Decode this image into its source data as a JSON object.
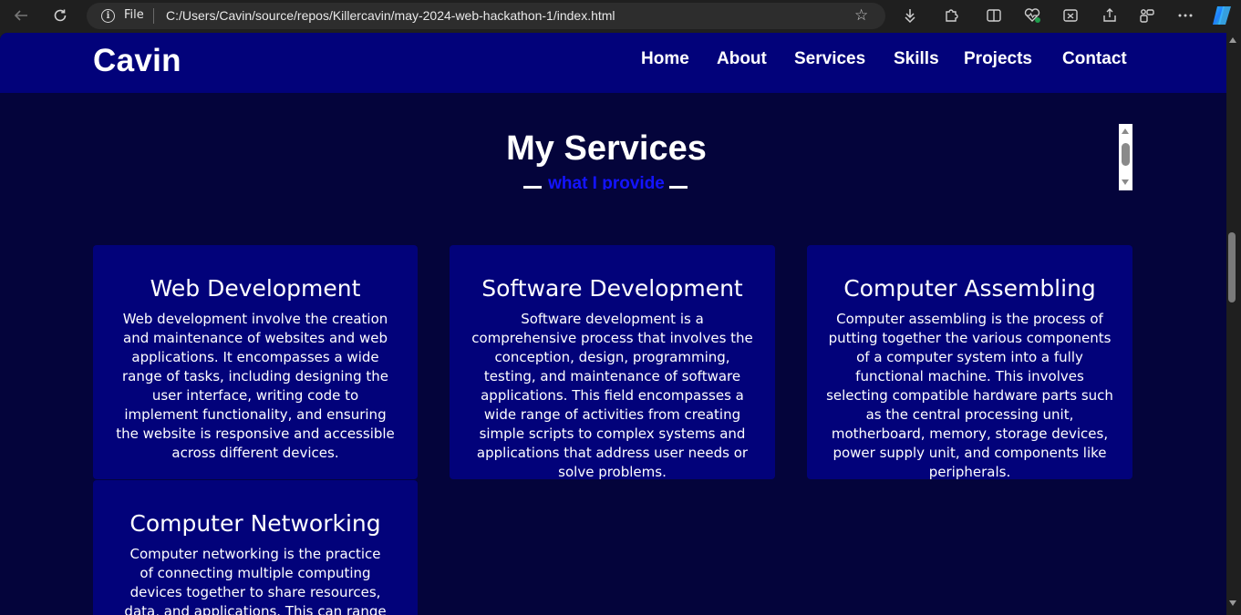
{
  "browser": {
    "address_prefix": "File",
    "url": "C:/Users/Cavin/source/repos/Killercavin/may-2024-web-hackathon-1/index.html",
    "icons": [
      "back-icon",
      "reload-icon",
      "info-icon",
      "star-icon",
      "extensions-download-icon",
      "puzzle-icon",
      "split-screen-icon",
      "health-icon",
      "screenshot-icon",
      "share-icon",
      "collections-icon",
      "more-icon",
      "copilot-icon"
    ]
  },
  "navbar": {
    "logo": "Cavin",
    "links": [
      "Home",
      "About",
      "Services",
      "Skills",
      "Projects",
      "Contact"
    ]
  },
  "section": {
    "title": "My Services",
    "subtitle": "what I provide"
  },
  "cards": [
    {
      "title": "Web Development",
      "text": "Web development involve the creation and maintenance of websites and web applications. It encompasses a wide range of tasks, including designing the user interface, writing code to implement functionality, and ensuring the website is responsive and accessible across different devices."
    },
    {
      "title": "Software Development",
      "text": "Software development is a comprehensive process that involves the conception, design, programming, testing, and maintenance of software applications. This field encompasses a wide range of activities from creating simple scripts to complex systems and applications that address user needs or solve problems."
    },
    {
      "title": "Computer Assembling",
      "text": "Computer assembling is the process of putting together the various components of a computer system into a fully functional machine. This involves selecting compatible hardware parts such as the central processing unit, motherboard, memory, storage devices, power supply unit, and components like peripherals."
    },
    {
      "title": "Computer Networking",
      "text": "Computer networking is the practice of connecting multiple computing devices together to share resources, data, and applications. This can range from simple"
    }
  ],
  "colors": {
    "page_bg": "#04043b",
    "navbar_bg": "#02027a",
    "card_bg": "#02027a",
    "subtitle": "#1414ff",
    "chrome_bg": "#1f1f1f"
  }
}
